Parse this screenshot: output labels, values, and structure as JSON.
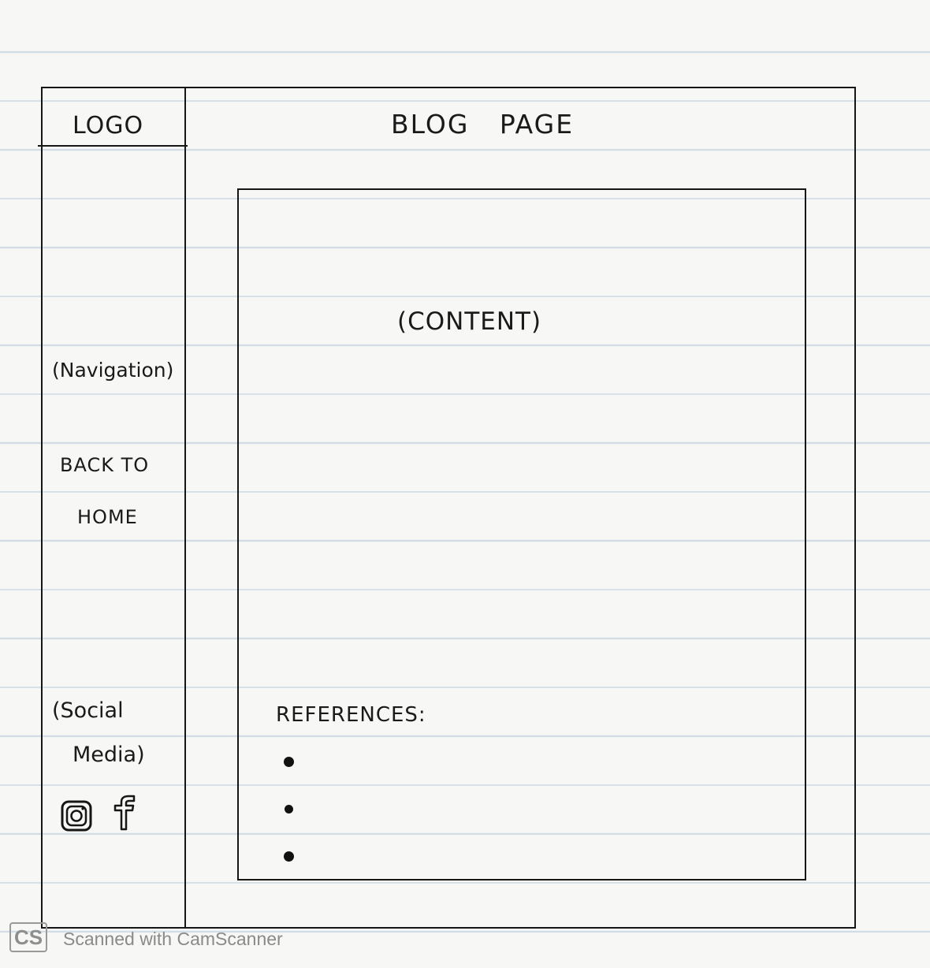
{
  "header": {
    "logo": "LOGO",
    "title": "BLOG PAGE"
  },
  "sidebar": {
    "navigation_label": "(Navigation)",
    "back_home_line1": "BACK TO",
    "back_home_line2": "HOME",
    "social_line1": "(Social",
    "social_line2": "Media)",
    "social_icons": [
      "instagram-icon",
      "facebook-icon"
    ]
  },
  "main": {
    "content_label": "(CONTENT)",
    "references_label": "REFERENCES:",
    "reference_items": [
      "",
      "",
      ""
    ]
  },
  "watermark": {
    "logo": "CS",
    "text": "Scanned with CamScanner"
  }
}
